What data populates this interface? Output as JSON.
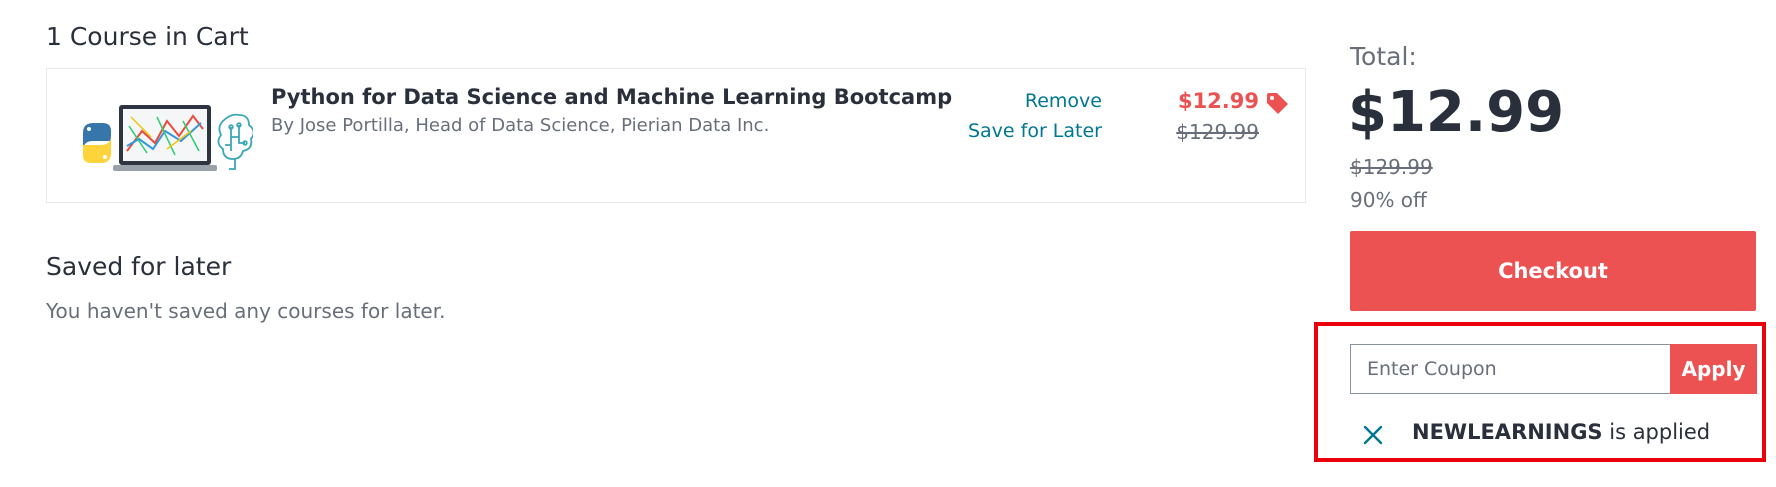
{
  "cart": {
    "heading": "1 Course in Cart",
    "items": [
      {
        "title": "Python for Data Science and Machine Learning Bootcamp",
        "author": "By Jose Portilla, Head of Data Science, Pierian Data Inc.",
        "remove_label": "Remove",
        "save_label": "Save for Later",
        "price": "$12.99",
        "original_price": "$129.99",
        "thumbnail_icons": [
          "python-logo-icon",
          "laptop-chart-icon",
          "brain-circuit-icon"
        ]
      }
    ]
  },
  "saved": {
    "heading": "Saved for later",
    "empty_message": "You haven't saved any courses for later."
  },
  "summary": {
    "total_label": "Total:",
    "total_amount": "$12.99",
    "original_total": "$129.99",
    "discount": "90% off",
    "checkout_label": "Checkout"
  },
  "coupon": {
    "placeholder": "Enter Coupon",
    "apply_label": "Apply",
    "applied_code": "NEWLEARNINGS",
    "applied_suffix": " is applied"
  },
  "colors": {
    "accent": "#ec5252",
    "link": "#007791",
    "text": "#29303b",
    "muted": "#686f7a",
    "highlight": "#e8000b"
  }
}
